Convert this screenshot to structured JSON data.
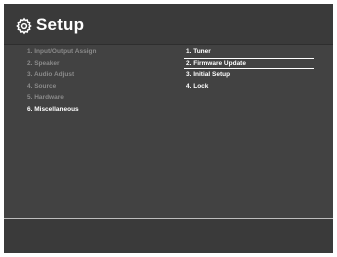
{
  "header": {
    "icon": "gear-icon",
    "title": "Setup"
  },
  "left_menu": {
    "items": [
      {
        "label": "1. Input/Output Assign",
        "active": false
      },
      {
        "label": "2. Speaker",
        "active": false
      },
      {
        "label": "3. Audio Adjust",
        "active": false
      },
      {
        "label": "4. Source",
        "active": false
      },
      {
        "label": "5. Hardware",
        "active": false
      },
      {
        "label": "6. Miscellaneous",
        "active": true
      }
    ]
  },
  "right_menu": {
    "items": [
      {
        "label": "1. Tuner",
        "selected": false
      },
      {
        "label": "2. Firmware Update",
        "selected": true
      },
      {
        "label": "3. Initial Setup",
        "selected": false
      },
      {
        "label": "4. Lock",
        "selected": false
      }
    ]
  },
  "colors": {
    "background": "#3d3d3d",
    "text_active": "#ffffff",
    "text_inactive": "#8a8a8a",
    "selection_border": "#ffffff"
  }
}
